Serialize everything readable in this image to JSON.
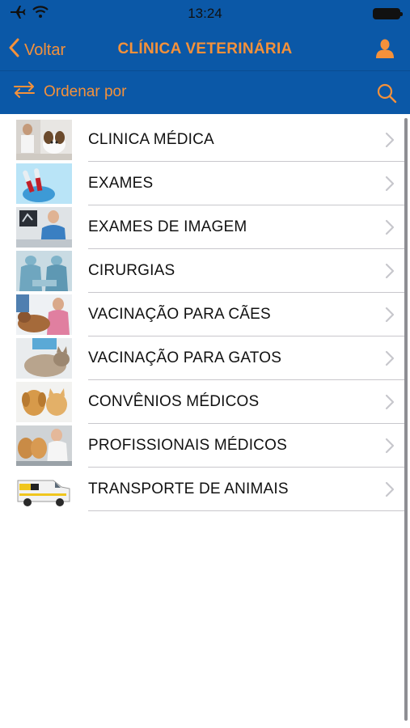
{
  "status": {
    "time": "13:24"
  },
  "nav": {
    "back_label": "Voltar",
    "title": "CLÍNICA VETERINÁRIA"
  },
  "sortbar": {
    "sort_label": "Ordenar por"
  },
  "colors": {
    "bar": "#0b58a7",
    "accent": "#f5913a"
  },
  "items": [
    {
      "label": "CLINICA MÉDICA"
    },
    {
      "label": "EXAMES"
    },
    {
      "label": "EXAMES DE IMAGEM"
    },
    {
      "label": "CIRURGIAS"
    },
    {
      "label": "VACINAÇÃO PARA CÃES"
    },
    {
      "label": "VACINAÇÃO PARA GATOS"
    },
    {
      "label": "CONVÊNIOS MÉDICOS"
    },
    {
      "label": "PROFISSIONAIS MÉDICOS"
    },
    {
      "label": "TRANSPORTE DE ANIMAIS"
    }
  ]
}
